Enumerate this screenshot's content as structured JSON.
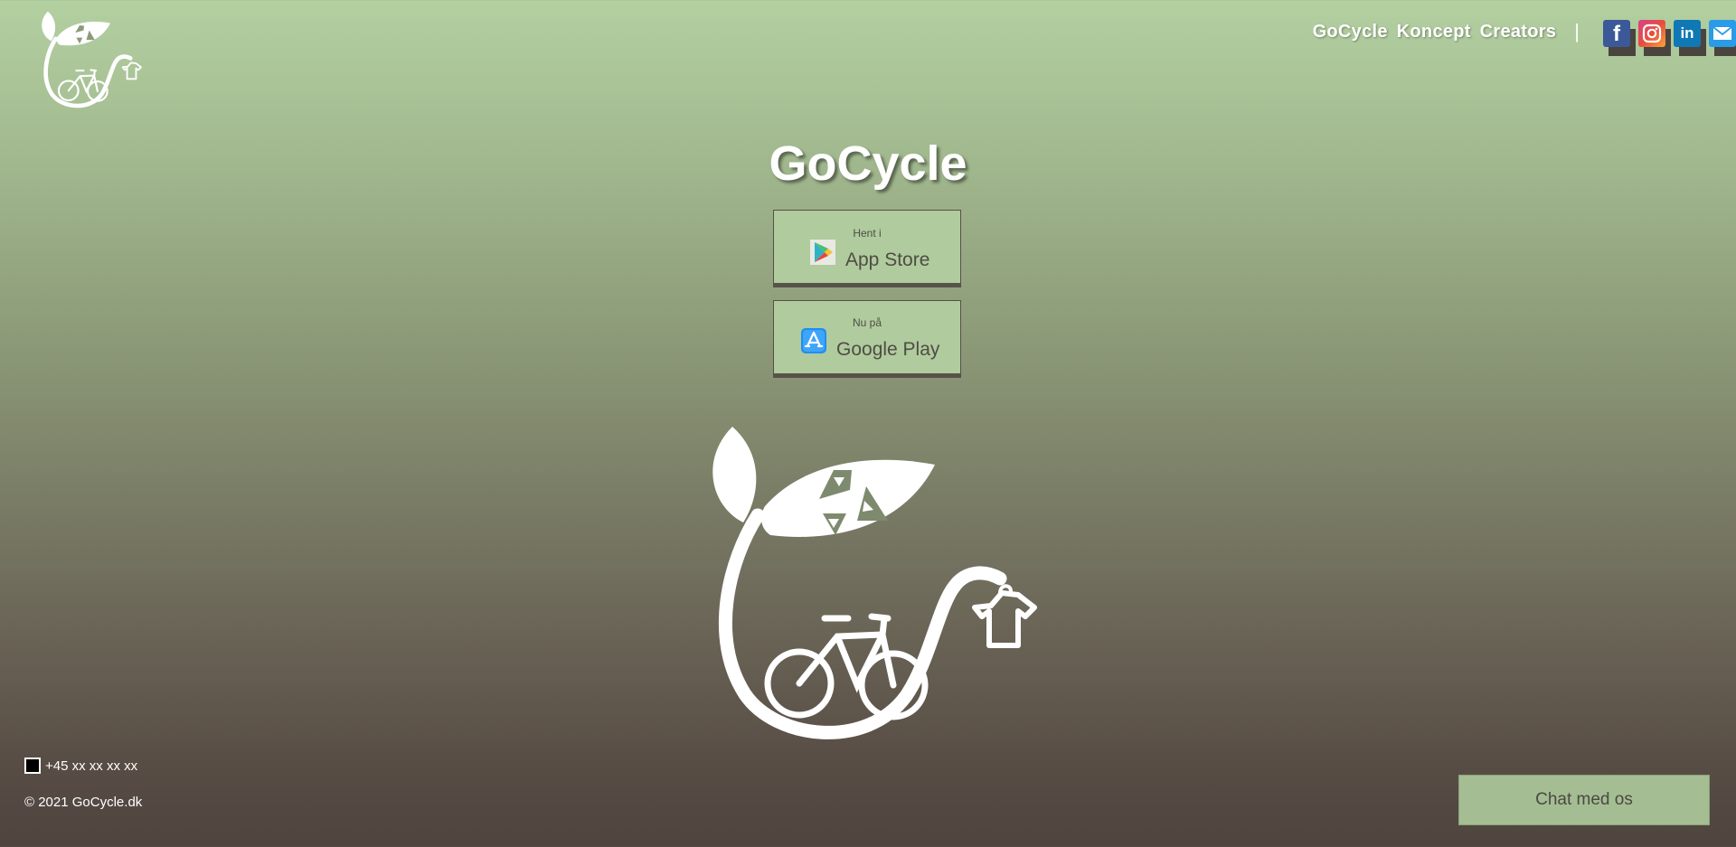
{
  "header": {
    "brand_text": "GoCycle Koncept Creators",
    "separator": "|",
    "socials": [
      {
        "name": "facebook-icon",
        "glyph": "f"
      },
      {
        "name": "instagram-icon",
        "glyph": ""
      },
      {
        "name": "linkedin-icon",
        "glyph": "in"
      },
      {
        "name": "mail-icon",
        "glyph": ""
      }
    ]
  },
  "main": {
    "title": "GoCycle",
    "buttons": [
      {
        "small": "Hent i",
        "label": "App Store",
        "icon": "google-play-icon"
      },
      {
        "small": "Nu på",
        "label": "Google Play",
        "icon": "app-store-icon"
      }
    ]
  },
  "footer": {
    "phone": "+45 xx xx xx xx",
    "copyright": "© 2021 GoCycle.dk",
    "chat_label": "Chat med os"
  },
  "colors": {
    "button_bg": "#b0cb9d",
    "chat_bg": "#a5bd92",
    "gradient_top": "#b3d0a1",
    "gradient_bottom": "#4f443e"
  }
}
